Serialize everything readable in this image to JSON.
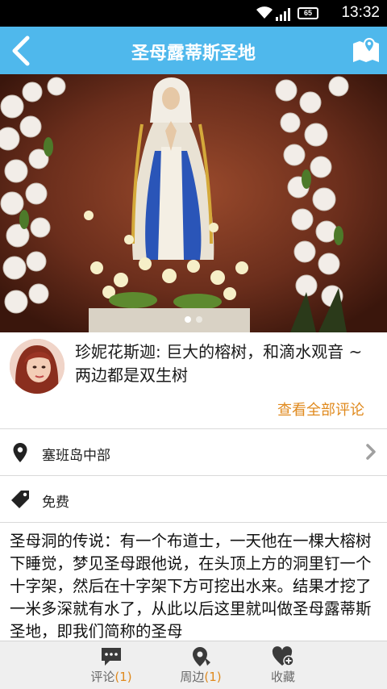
{
  "status_bar": {
    "time": "13:32",
    "battery": "65",
    "icons": [
      "wifi-icon",
      "signal-icon",
      "battery-icon"
    ]
  },
  "header": {
    "title": "圣母露蒂斯圣地",
    "back_icon": "chevron-left-icon",
    "map_icon": "map-pin-icon"
  },
  "banner": {
    "image": "statue-of-virgin-mary-with-flowers",
    "page_count": 2,
    "active_page": 1
  },
  "review": {
    "text": "珍妮花斯迦: 巨大的榕树，和滴水观音 ~两边都是双生树",
    "view_all": "查看全部评论"
  },
  "info": {
    "location": "塞班岛中部",
    "price": "免费"
  },
  "description": "圣母洞的传说：有一个布道士，一天他在一棵大榕树下睡觉，梦见圣母跟他说，在头顶上方的洞里钉一个十字架，然后在十字架下方可挖出水来。结果才挖了一米多深就有水了，从此以后这里就叫做圣母露蒂斯圣地，即我们简称的圣母",
  "tabs": {
    "comments": {
      "label": "评论",
      "count": "(1)"
    },
    "nearby": {
      "label": "周边",
      "count": "(1)"
    },
    "favorite": {
      "label": "收藏"
    }
  },
  "colors": {
    "header": "#4fb8ec",
    "accent": "#e08a1e",
    "tab_bar": "#efefef"
  }
}
